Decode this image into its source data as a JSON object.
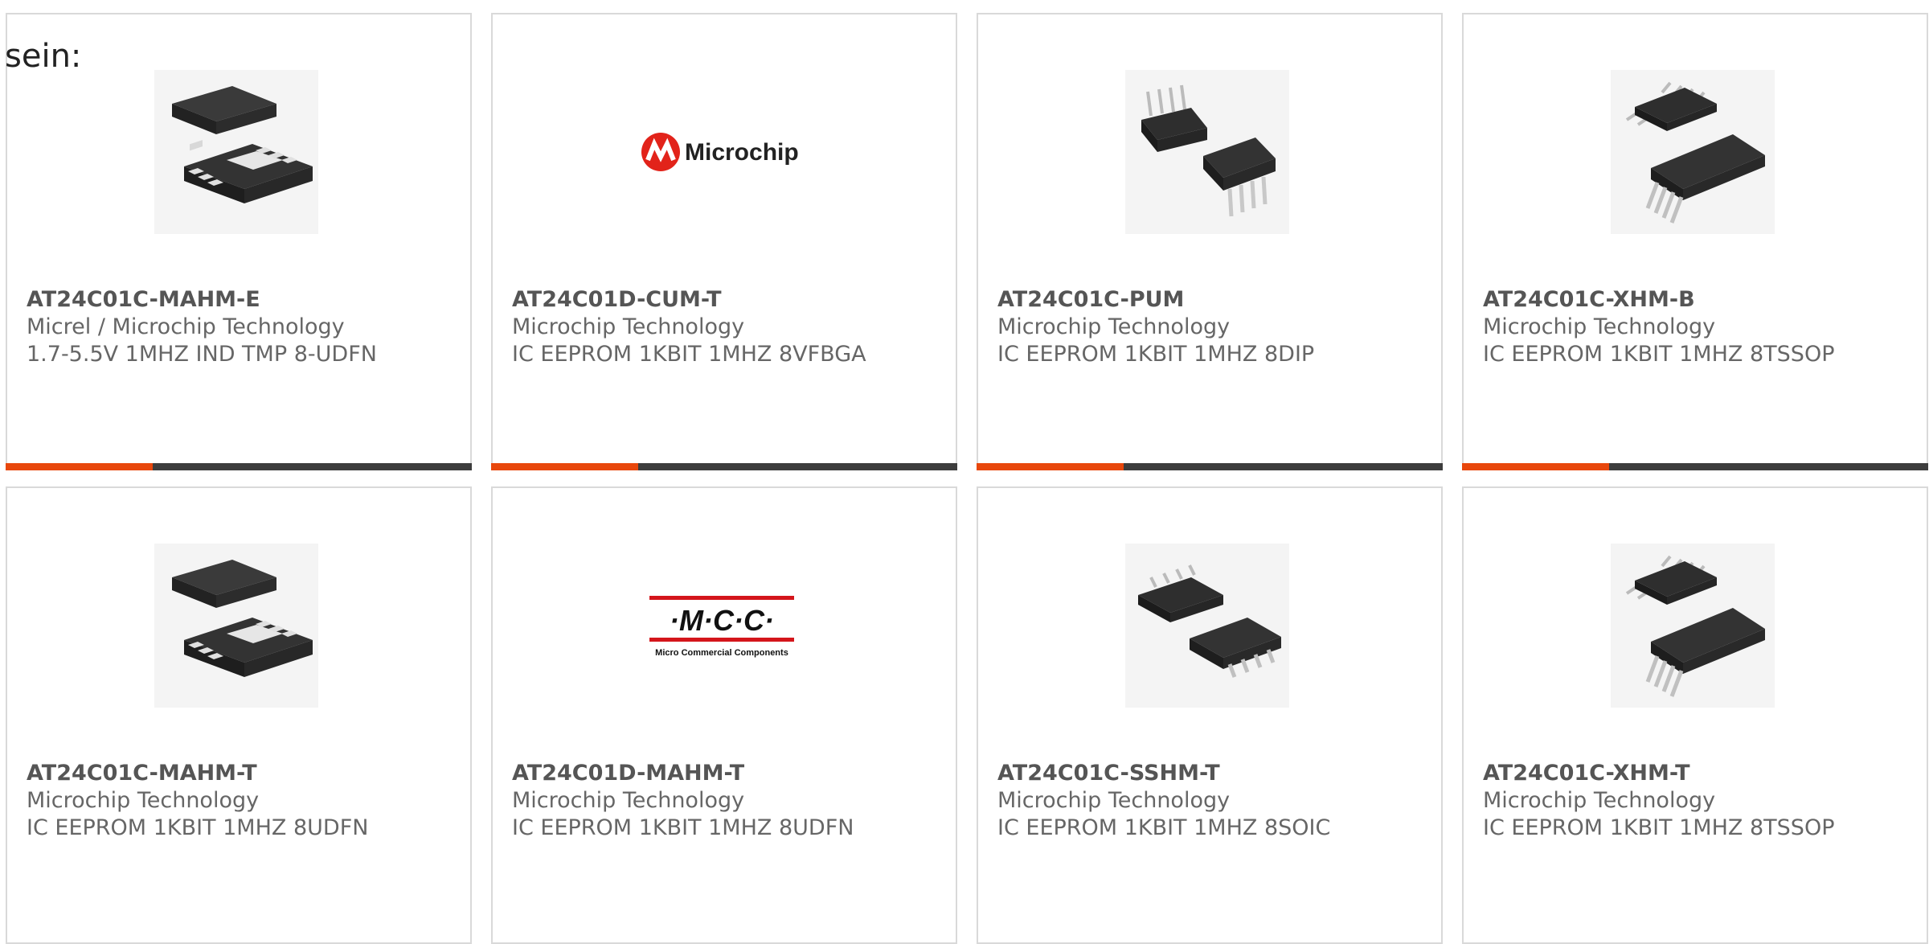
{
  "intro": "sein:",
  "colors": {
    "accent": "#e8470c",
    "bar": "#3d3d3d",
    "border": "#d9d9d9"
  },
  "products": [
    {
      "part": "AT24C01C-MAHM-E",
      "manufacturer": "Micrel / Microchip Technology",
      "description": "1.7-5.5V 1MHZ IND TMP 8-UDFN",
      "image": "udfn-package-icon"
    },
    {
      "part": "AT24C01D-CUM-T",
      "manufacturer": "Microchip Technology",
      "description": "IC EEPROM 1KBIT 1MHZ 8VFBGA",
      "image": "microchip-logo",
      "logo_text": "Microchip"
    },
    {
      "part": "AT24C01C-PUM",
      "manufacturer": "Microchip Technology",
      "description": "IC EEPROM 1KBIT 1MHZ 8DIP",
      "image": "dip-package-icon"
    },
    {
      "part": "AT24C01C-XHM-B",
      "manufacturer": "Microchip Technology",
      "description": "IC EEPROM 1KBIT 1MHZ 8TSSOP",
      "image": "tssop-package-icon"
    },
    {
      "part": "AT24C01C-MAHM-T",
      "manufacturer": "Microchip Technology",
      "description": "IC EEPROM 1KBIT 1MHZ 8UDFN",
      "image": "udfn-package-icon"
    },
    {
      "part": "AT24C01D-MAHM-T",
      "manufacturer": "Microchip Technology",
      "description": "IC EEPROM 1KBIT 1MHZ 8UDFN",
      "image": "mcc-logo",
      "logo_text": "·M·C·C·",
      "logo_subtext": "Micro Commercial Components"
    },
    {
      "part": "AT24C01C-SSHM-T",
      "manufacturer": "Microchip Technology",
      "description": "IC EEPROM 1KBIT 1MHZ 8SOIC",
      "image": "soic-package-icon"
    },
    {
      "part": "AT24C01C-XHM-T",
      "manufacturer": "Microchip Technology",
      "description": "IC EEPROM 1KBIT 1MHZ 8TSSOP",
      "image": "tssop-package-icon"
    }
  ]
}
